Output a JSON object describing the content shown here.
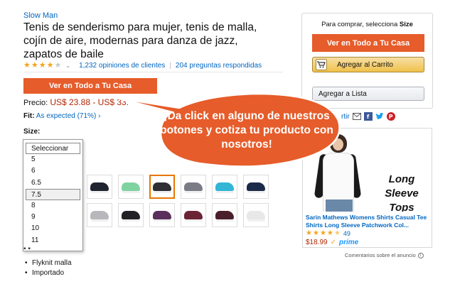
{
  "brand": "Slow Man",
  "product_title": "Tenis de senderismo para mujer, tenis de malla, cojín de aire, modernas para danza de jazz, zapatos de baile",
  "rating": {
    "stars": 4,
    "reviews": "1,232 opiniones de clientes",
    "questions": "204 preguntas respondidas"
  },
  "main_button": "Ver en Todo a Tu Casa",
  "price": {
    "label": "Precio:",
    "value": "US$ 23.88 - US$ 33."
  },
  "fit": {
    "label": "Fit:",
    "value": "As expected (71%)",
    "chev": "›"
  },
  "size": {
    "label": "Size:",
    "options": [
      "Seleccionar",
      "5",
      "6",
      "6.5",
      "7.5",
      "8",
      "9",
      "10",
      "11"
    ],
    "selected_index": 0,
    "hover_index": 4
  },
  "colors": {
    "accent_orange": "#e65c2a",
    "link_blue": "#0066c0",
    "price_red": "#b12704",
    "star": "#f4a41d",
    "swatch_selected": "#e77600"
  },
  "swatches": [
    {
      "name": "black-blue",
      "color": "#1f2430"
    },
    {
      "name": "mint",
      "color": "#7fd3a0"
    },
    {
      "name": "dark-gray",
      "color": "#2e2e34"
    },
    {
      "name": "gray-pink",
      "color": "#7b7b86"
    },
    {
      "name": "aqua",
      "color": "#33b5d6"
    },
    {
      "name": "navy",
      "color": "#1c2a4a"
    },
    {
      "name": "light-gray",
      "color": "#b8b8bc"
    },
    {
      "name": "black-white",
      "color": "#222226"
    },
    {
      "name": "purple",
      "color": "#5a2f5c"
    },
    {
      "name": "burgundy",
      "color": "#6b2436"
    },
    {
      "name": "maroon",
      "color": "#4a1e2a"
    },
    {
      "name": "white",
      "color": "#e8e8ea"
    }
  ],
  "selected_swatch": 2,
  "bullets": [
    "Flyknit malla",
    "Importado"
  ],
  "buybox": {
    "note_prefix": "Para comprar, selecciona",
    "note_bold": "Size",
    "primary": "Ver en Todo a Tu Casa",
    "cart": "Agregar al Carrito",
    "list": "Agregar a Lista"
  },
  "share": {
    "text": "rtir"
  },
  "callout": "¡Da click en alguno de nuestros botones y cotiza tu producto con nosotros!",
  "ad": {
    "caption": "Long Sleeve Tops",
    "title": "Sarin Mathews Womens Shirts Casual Tee Shirts Long Sleeve Patchwork Col...",
    "stars": 4.5,
    "count": "49",
    "price": "$18.99",
    "prime": "prime"
  },
  "ad_feedback": "Comentarios sobre el anuncio"
}
